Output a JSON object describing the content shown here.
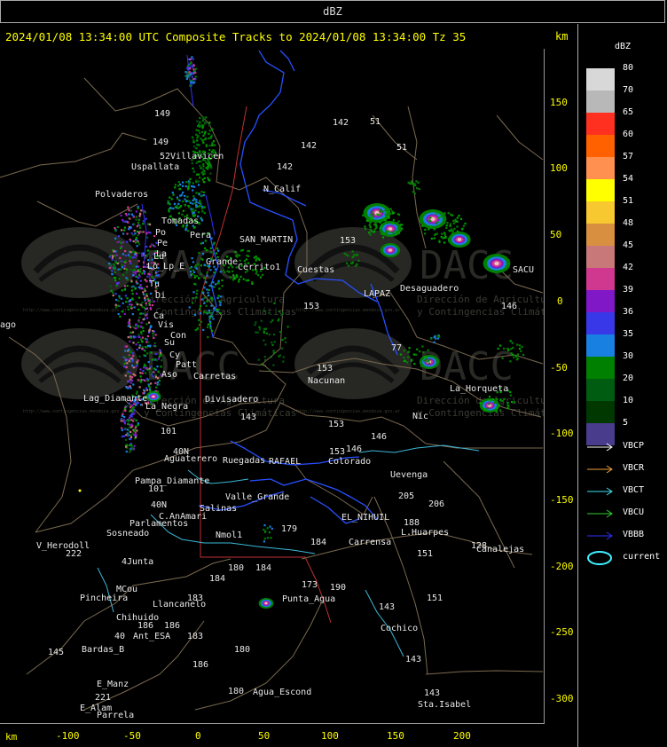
{
  "header": {
    "field": "dBZ"
  },
  "title": {
    "text": "2024/01/08 13:34:00 UTC Composite Tracks to 2024/01/08 13:34:00 Tz 35",
    "unit": "km"
  },
  "axes": {
    "y_unit": "km",
    "x_unit": "km",
    "y_ticks": [
      "150",
      "100",
      "50",
      "0",
      "-50",
      "-100",
      "-150",
      "-200",
      "-250",
      "-300"
    ],
    "x_ticks": [
      "-100",
      "-50",
      "0",
      "50",
      "100",
      "150",
      "200"
    ]
  },
  "legend": {
    "title": "dBZ",
    "scale": [
      {
        "label": "80",
        "color": "#d8d8d8"
      },
      {
        "label": "70",
        "color": "#b8b8b8"
      },
      {
        "label": "65",
        "color": "#ff3020"
      },
      {
        "label": "60",
        "color": "#ff6000"
      },
      {
        "label": "57",
        "color": "#ff9050"
      },
      {
        "label": "54",
        "color": "#ffff00"
      },
      {
        "label": "51",
        "color": "#f8c830"
      },
      {
        "label": "48",
        "color": "#d89040"
      },
      {
        "label": "45",
        "color": "#c87878"
      },
      {
        "label": "42",
        "color": "#d03890"
      },
      {
        "label": "39",
        "color": "#8018c8"
      },
      {
        "label": "36",
        "color": "#3838e8"
      },
      {
        "label": "35",
        "color": "#1880e0"
      },
      {
        "label": "30",
        "color": "#008000"
      },
      {
        "label": "20",
        "color": "#005c10"
      },
      {
        "label": "10",
        "color": "#003800"
      },
      {
        "label": "5",
        "color": "#4a3c8c"
      }
    ],
    "tracks": [
      {
        "label": "VBCP",
        "color": "#ffffff"
      },
      {
        "label": "VBCR",
        "color": "#f0a040"
      },
      {
        "label": "VBCT",
        "color": "#40e0f0"
      },
      {
        "label": "VBCU",
        "color": "#30d030"
      },
      {
        "label": "VBBB",
        "color": "#3030ff"
      }
    ],
    "current": {
      "label": "current",
      "color": "#40f0ff"
    }
  },
  "map": {
    "place_labels": [
      {
        "t": "149",
        "x": 174,
        "y": 131
      },
      {
        "t": "149",
        "x": 172,
        "y": 163
      },
      {
        "t": "Uspallata",
        "x": 148,
        "y": 191
      },
      {
        "t": "52Villavicen",
        "x": 180,
        "y": 179
      },
      {
        "t": "Polvaderos",
        "x": 107,
        "y": 222
      },
      {
        "t": "Po",
        "x": 175,
        "y": 265
      },
      {
        "t": "Pe",
        "x": 177,
        "y": 277
      },
      {
        "t": "La",
        "x": 176,
        "y": 289
      },
      {
        "t": "Lu",
        "x": 173,
        "y": 292
      },
      {
        "t": "Lo_Lp_E",
        "x": 166,
        "y": 303
      },
      {
        "t": "Tu",
        "x": 168,
        "y": 323
      },
      {
        "t": "Di",
        "x": 175,
        "y": 336
      },
      {
        "t": "Ca",
        "x": 173,
        "y": 359
      },
      {
        "t": "Vis",
        "x": 178,
        "y": 369
      },
      {
        "t": "Con",
        "x": 192,
        "y": 381
      },
      {
        "t": "Su",
        "x": 185,
        "y": 389
      },
      {
        "t": "Cy",
        "x": 191,
        "y": 403
      },
      {
        "t": "Patt",
        "x": 198,
        "y": 414
      },
      {
        "t": "Tomadas",
        "x": 182,
        "y": 252
      },
      {
        "t": "Pera",
        "x": 214,
        "y": 268
      },
      {
        "t": "Grande",
        "x": 232,
        "y": 298
      },
      {
        "t": "SAN_MARTIN",
        "x": 270,
        "y": 273
      },
      {
        "t": "Cerrito1",
        "x": 268,
        "y": 304
      },
      {
        "t": "Cuestas",
        "x": 335,
        "y": 307
      },
      {
        "t": "N_Calif",
        "x": 297,
        "y": 216
      },
      {
        "t": "142",
        "x": 375,
        "y": 141
      },
      {
        "t": "142",
        "x": 339,
        "y": 167
      },
      {
        "t": "142",
        "x": 312,
        "y": 191
      },
      {
        "t": "51",
        "x": 417,
        "y": 140
      },
      {
        "t": "51",
        "x": 447,
        "y": 169
      },
      {
        "t": "153",
        "x": 383,
        "y": 274
      },
      {
        "t": "153",
        "x": 342,
        "y": 348
      },
      {
        "t": "Desaguadero",
        "x": 451,
        "y": 328
      },
      {
        "t": "LAPAZ",
        "x": 410,
        "y": 334
      },
      {
        "t": "146",
        "x": 565,
        "y": 348
      },
      {
        "t": "77",
        "x": 441,
        "y": 395
      },
      {
        "t": "153",
        "x": 357,
        "y": 418
      },
      {
        "t": "Nacunan",
        "x": 347,
        "y": 432
      },
      {
        "t": "La_Horqueta",
        "x": 507,
        "y": 441
      },
      {
        "t": "Nic",
        "x": 465,
        "y": 472
      },
      {
        "t": "Aso",
        "x": 182,
        "y": 425
      },
      {
        "t": "Carretas",
        "x": 218,
        "y": 427
      },
      {
        "t": "Divisadero",
        "x": 231,
        "y": 453
      },
      {
        "t": "Lag_Diamante",
        "x": 94,
        "y": 452
      },
      {
        "t": "La_Negra",
        "x": 164,
        "y": 461
      },
      {
        "t": "143",
        "x": 271,
        "y": 473
      },
      {
        "t": "153",
        "x": 370,
        "y": 481
      },
      {
        "t": "146",
        "x": 418,
        "y": 495
      },
      {
        "t": "101",
        "x": 181,
        "y": 489
      },
      {
        "t": "40N",
        "x": 195,
        "y": 512
      },
      {
        "t": "Aguaterero",
        "x": 185,
        "y": 520
      },
      {
        "t": "Pampa_Diamante",
        "x": 152,
        "y": 545
      },
      {
        "t": "101",
        "x": 167,
        "y": 554
      },
      {
        "t": "Ruegadas",
        "x": 251,
        "y": 522
      },
      {
        "t": "RAFAEL",
        "x": 303,
        "y": 523
      },
      {
        "t": "Colorado",
        "x": 370,
        "y": 523
      },
      {
        "t": "146",
        "x": 390,
        "y": 509
      },
      {
        "t": "153",
        "x": 371,
        "y": 512
      },
      {
        "t": "Uevenga",
        "x": 440,
        "y": 538
      },
      {
        "t": "205",
        "x": 449,
        "y": 562
      },
      {
        "t": "206",
        "x": 483,
        "y": 571
      },
      {
        "t": "Valle_Grande",
        "x": 254,
        "y": 563
      },
      {
        "t": "40N",
        "x": 170,
        "y": 572
      },
      {
        "t": "C.AnAmari",
        "x": 179,
        "y": 585
      },
      {
        "t": "Salinas",
        "x": 225,
        "y": 576
      },
      {
        "t": "Parlamentos",
        "x": 146,
        "y": 593
      },
      {
        "t": "Sosneado",
        "x": 120,
        "y": 604
      },
      {
        "t": "V_Herodoll",
        "x": 41,
        "y": 618
      },
      {
        "t": "222",
        "x": 74,
        "y": 627
      },
      {
        "t": "4Junta",
        "x": 137,
        "y": 636
      },
      {
        "t": "Nmol1",
        "x": 243,
        "y": 606
      },
      {
        "t": "179",
        "x": 317,
        "y": 599
      },
      {
        "t": "184",
        "x": 350,
        "y": 614
      },
      {
        "t": "EL_NIHUIL",
        "x": 385,
        "y": 586
      },
      {
        "t": "Carrensa",
        "x": 393,
        "y": 614
      },
      {
        "t": "188",
        "x": 455,
        "y": 592
      },
      {
        "t": "L.Huarpes",
        "x": 452,
        "y": 603
      },
      {
        "t": "151",
        "x": 470,
        "y": 627
      },
      {
        "t": "128",
        "x": 531,
        "y": 618
      },
      {
        "t": "Canalejas",
        "x": 537,
        "y": 622
      },
      {
        "t": "180",
        "x": 257,
        "y": 643
      },
      {
        "t": "184",
        "x": 236,
        "y": 655
      },
      {
        "t": "184",
        "x": 288,
        "y": 643
      },
      {
        "t": "173",
        "x": 340,
        "y": 662
      },
      {
        "t": "190",
        "x": 372,
        "y": 665
      },
      {
        "t": "Punta_Agua",
        "x": 318,
        "y": 678
      },
      {
        "t": "MCou",
        "x": 131,
        "y": 667
      },
      {
        "t": "Pincheira",
        "x": 90,
        "y": 677
      },
      {
        "t": "Llancanelo",
        "x": 172,
        "y": 684
      },
      {
        "t": "183",
        "x": 211,
        "y": 677
      },
      {
        "t": "Chihuido",
        "x": 131,
        "y": 699
      },
      {
        "t": "186",
        "x": 155,
        "y": 708
      },
      {
        "t": "186",
        "x": 185,
        "y": 708
      },
      {
        "t": "Ant_ESA",
        "x": 150,
        "y": 720
      },
      {
        "t": "40",
        "x": 129,
        "y": 720
      },
      {
        "t": "183",
        "x": 211,
        "y": 720
      },
      {
        "t": "151",
        "x": 481,
        "y": 677
      },
      {
        "t": "143",
        "x": 427,
        "y": 687
      },
      {
        "t": "Cochico",
        "x": 429,
        "y": 711
      },
      {
        "t": "145",
        "x": 54,
        "y": 738
      },
      {
        "t": "Bardas_B",
        "x": 92,
        "y": 735
      },
      {
        "t": "180",
        "x": 264,
        "y": 735
      },
      {
        "t": "186",
        "x": 217,
        "y": 752
      },
      {
        "t": "143",
        "x": 457,
        "y": 746
      },
      {
        "t": "E_Manz",
        "x": 109,
        "y": 774
      },
      {
        "t": "180",
        "x": 257,
        "y": 782
      },
      {
        "t": "Agua_Escond",
        "x": 285,
        "y": 783
      },
      {
        "t": "221",
        "x": 107,
        "y": 789
      },
      {
        "t": "E_Alam",
        "x": 90,
        "y": 801
      },
      {
        "t": "Parrela",
        "x": 109,
        "y": 809
      },
      {
        "t": "143",
        "x": 478,
        "y": 784
      },
      {
        "t": "Sta.Isabel",
        "x": 471,
        "y": 797
      },
      {
        "t": "SACU",
        "x": 578,
        "y": 307
      },
      {
        "t": "ago",
        "x": 0,
        "y": 369
      }
    ],
    "watermark": {
      "brand": "DACC",
      "org_line1": "Dirección de Agricultura",
      "org_line2": "y Contingencias Climáticas",
      "url": "http://www.contingencias.mendoza.gov.ar"
    }
  }
}
